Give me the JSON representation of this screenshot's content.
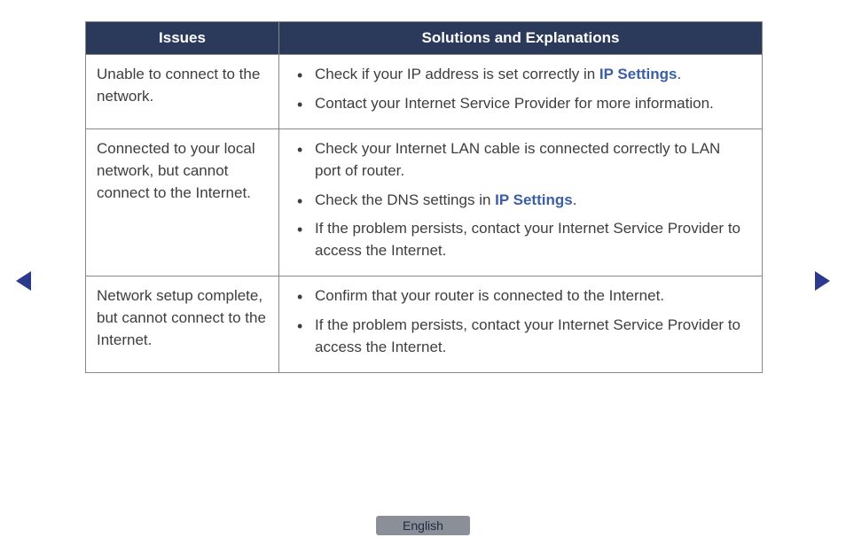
{
  "table": {
    "headers": {
      "issues": "Issues",
      "solutions": "Solutions and Explanations"
    },
    "rows": [
      {
        "issue": "Unable to connect to the network.",
        "solutions": [
          {
            "pre": "Check if your IP address is set correctly in ",
            "link": "IP Settings",
            "post": "."
          },
          {
            "pre": "Contact your Internet Service Provider for more information.",
            "link": "",
            "post": ""
          }
        ]
      },
      {
        "issue": "Connected to your local network, but cannot connect to the Internet.",
        "solutions": [
          {
            "pre": "Check your Internet LAN cable is connected correctly to LAN port of router.",
            "link": "",
            "post": ""
          },
          {
            "pre": "Check the DNS settings in ",
            "link": "IP Settings",
            "post": "."
          },
          {
            "pre": "If the problem persists, contact your Internet Service Provider to access the Internet.",
            "link": "",
            "post": ""
          }
        ]
      },
      {
        "issue": "Network setup complete, but cannot connect to the Internet.",
        "solutions": [
          {
            "pre": "Confirm that your router is connected to the Internet.",
            "link": "",
            "post": ""
          },
          {
            "pre": "If the problem persists, contact your Internet Service Provider to access the Internet.",
            "link": "",
            "post": ""
          }
        ]
      }
    ]
  },
  "language": "English"
}
